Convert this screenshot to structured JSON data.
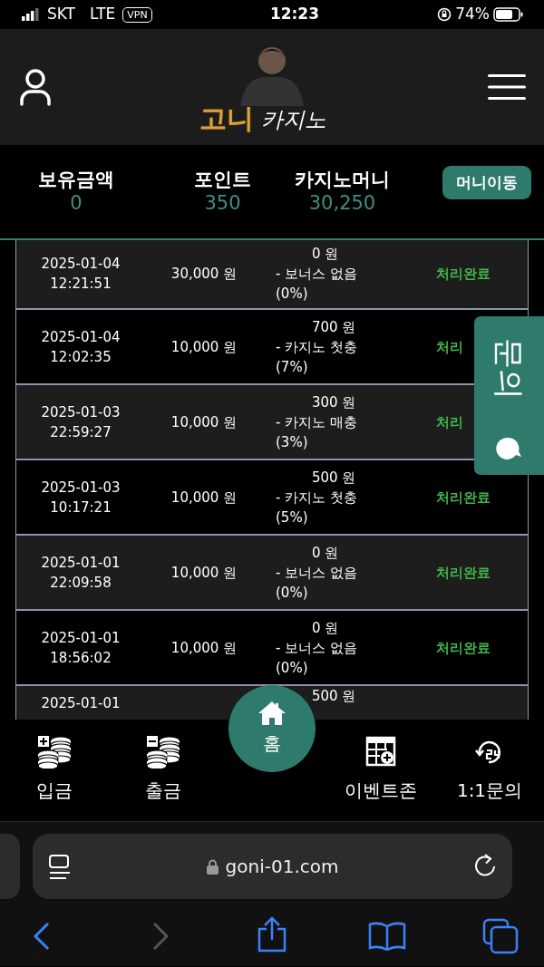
{
  "status_bar": {
    "carrier": "SKT",
    "network": "LTE",
    "vpn": "VPN",
    "time": "12:23",
    "battery": "74%"
  },
  "header": {
    "logo_gold": "고니",
    "logo_white": "카지노"
  },
  "balances": [
    {
      "label": "보유금액",
      "value": "0"
    },
    {
      "label": "포인트",
      "value": "350"
    },
    {
      "label": "카지노머니",
      "value": "30,250"
    }
  ],
  "money_transfer_button": "머니이동",
  "rows": [
    {
      "date": "2025-01-04",
      "time": "12:21:51",
      "amount": "30,000 원",
      "bonus_amount": "0 원",
      "bonus_name": "- 보너스 없음",
      "bonus_rate": "(0%)",
      "status": "처리완료"
    },
    {
      "date": "2025-01-04",
      "time": "12:02:35",
      "amount": "10,000 원",
      "bonus_amount": "700 원",
      "bonus_name": "- 카지노 첫충",
      "bonus_rate": "(7%)",
      "status": "처리"
    },
    {
      "date": "2025-01-03",
      "time": "22:59:27",
      "amount": "10,000 원",
      "bonus_amount": "300 원",
      "bonus_name": "- 카지노 매충",
      "bonus_rate": "(3%)",
      "status": "처리"
    },
    {
      "date": "2025-01-03",
      "time": "10:17:21",
      "amount": "10,000 원",
      "bonus_amount": "500 원",
      "bonus_name": "- 카지노 첫충",
      "bonus_rate": "(5%)",
      "status": "처리완료"
    },
    {
      "date": "2025-01-01",
      "time": "22:09:58",
      "amount": "10,000 원",
      "bonus_amount": "0 원",
      "bonus_name": "- 보너스 없음",
      "bonus_rate": "(0%)",
      "status": "처리완료"
    },
    {
      "date": "2025-01-01",
      "time": "18:56:02",
      "amount": "10,000 원",
      "bonus_amount": "0 원",
      "bonus_name": "- 보너스 없음",
      "bonus_rate": "(0%)",
      "status": "처리완료"
    },
    {
      "date": "2025-01-01",
      "bonus_amount": "500 원"
    }
  ],
  "side_tab": {
    "label": "문의"
  },
  "bottom_nav": [
    {
      "kind": "deposit",
      "label": "입금"
    },
    {
      "kind": "withdraw",
      "label": "출금"
    },
    {
      "kind": "home",
      "label": "홈"
    },
    {
      "kind": "event",
      "label": "이벤트존"
    },
    {
      "kind": "support",
      "label": "1:1문의"
    }
  ],
  "browser": {
    "url": "goni-01.com"
  }
}
